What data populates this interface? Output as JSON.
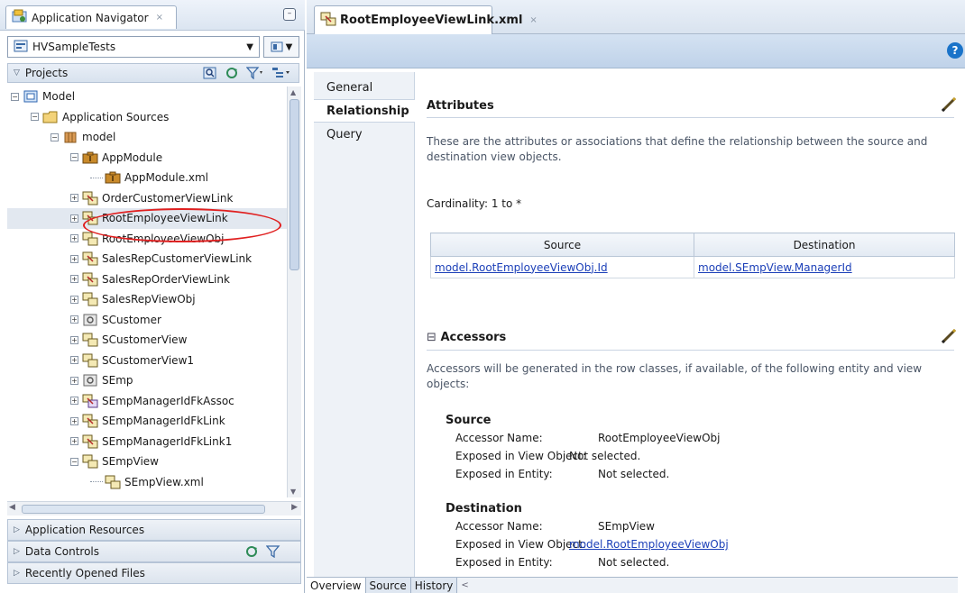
{
  "colors": {
    "accent": "#1b3fb8",
    "selection_ellipse": "#e02020",
    "help_badge": "#1a73c9"
  },
  "navigator": {
    "tab_label": "Application Navigator",
    "tab_close": "×",
    "minimize": "–",
    "project_select": "HVSampleTests",
    "projects_header": "Projects"
  },
  "tree": [
    {
      "label": "Model",
      "depth": 0,
      "exp": "−",
      "icon": "project-icon"
    },
    {
      "label": "Application Sources",
      "depth": 1,
      "exp": "−",
      "icon": "folder-icon"
    },
    {
      "label": "model",
      "depth": 2,
      "exp": "−",
      "icon": "package-icon"
    },
    {
      "label": "AppModule",
      "depth": 3,
      "exp": "−",
      "icon": "app-module-icon"
    },
    {
      "label": "AppModule.xml",
      "depth": 4,
      "exp": "",
      "icon": "app-module-icon"
    },
    {
      "label": "OrderCustomerViewLink",
      "depth": 3,
      "exp": "+",
      "icon": "view-link-icon"
    },
    {
      "label": "RootEmployeeViewLink",
      "depth": 3,
      "exp": "+",
      "icon": "view-link-icon",
      "selected": true
    },
    {
      "label": "RootEmployeeViewObj",
      "depth": 3,
      "exp": "+",
      "icon": "view-object-icon"
    },
    {
      "label": "SalesRepCustomerViewLink",
      "depth": 3,
      "exp": "+",
      "icon": "view-link-icon"
    },
    {
      "label": "SalesRepOrderViewLink",
      "depth": 3,
      "exp": "+",
      "icon": "view-link-icon"
    },
    {
      "label": "SalesRepViewObj",
      "depth": 3,
      "exp": "+",
      "icon": "view-object-icon"
    },
    {
      "label": "SCustomer",
      "depth": 3,
      "exp": "+",
      "icon": "entity-icon"
    },
    {
      "label": "SCustomerView",
      "depth": 3,
      "exp": "+",
      "icon": "view-object-icon"
    },
    {
      "label": "SCustomerView1",
      "depth": 3,
      "exp": "+",
      "icon": "view-object-icon"
    },
    {
      "label": "SEmp",
      "depth": 3,
      "exp": "+",
      "icon": "entity-icon"
    },
    {
      "label": "SEmpManagerIdFkAssoc",
      "depth": 3,
      "exp": "+",
      "icon": "association-icon"
    },
    {
      "label": "SEmpManagerIdFkLink",
      "depth": 3,
      "exp": "+",
      "icon": "view-link-icon"
    },
    {
      "label": "SEmpManagerIdFkLink1",
      "depth": 3,
      "exp": "+",
      "icon": "view-link-icon"
    },
    {
      "label": "SEmpView",
      "depth": 3,
      "exp": "−",
      "icon": "view-object-icon"
    },
    {
      "label": "SEmpView.xml",
      "depth": 4,
      "exp": "",
      "icon": "view-object-icon"
    }
  ],
  "accordion": {
    "app_resources": "Application Resources",
    "data_controls": "Data Controls",
    "recent_files": "Recently Opened Files"
  },
  "editor": {
    "tab_label": "RootEmployeeViewLink.xml",
    "tab_close": "×",
    "help": "?",
    "side_tabs": [
      "General",
      "Relationship",
      "Query"
    ],
    "attributes": {
      "title": "Attributes",
      "desc": "These are the attributes or associations that define the relationship between the source and destination view objects.",
      "cardinality_label": "Cardinality:",
      "cardinality_value": "1 to *",
      "col_source": "Source",
      "col_destination": "Destination",
      "source_value": "model.RootEmployeeViewObj.Id",
      "destination_value": "model.SEmpView.ManagerId"
    },
    "accessors": {
      "toggle": "⊟",
      "title": "Accessors",
      "desc": "Accessors will be generated in the row classes, if available, of the following entity and view objects:",
      "source": {
        "heading": "Source",
        "name_label": "Accessor Name:",
        "name_value": "RootEmployeeViewObj",
        "exposed_vo_label": "Exposed in View Object:",
        "exposed_vo_value": "Not selected.",
        "exposed_entity_label": "Exposed in Entity:",
        "exposed_entity_value": "Not selected."
      },
      "destination": {
        "heading": "Destination",
        "name_label": "Accessor Name:",
        "name_value": "SEmpView",
        "exposed_vo_label": "Exposed in View Object:",
        "exposed_vo_value": "model.RootEmployeeViewObj",
        "exposed_entity_label": "Exposed in Entity:",
        "exposed_entity_value": "Not selected."
      }
    },
    "bottom_tabs": [
      "Overview",
      "Source",
      "History"
    ]
  }
}
